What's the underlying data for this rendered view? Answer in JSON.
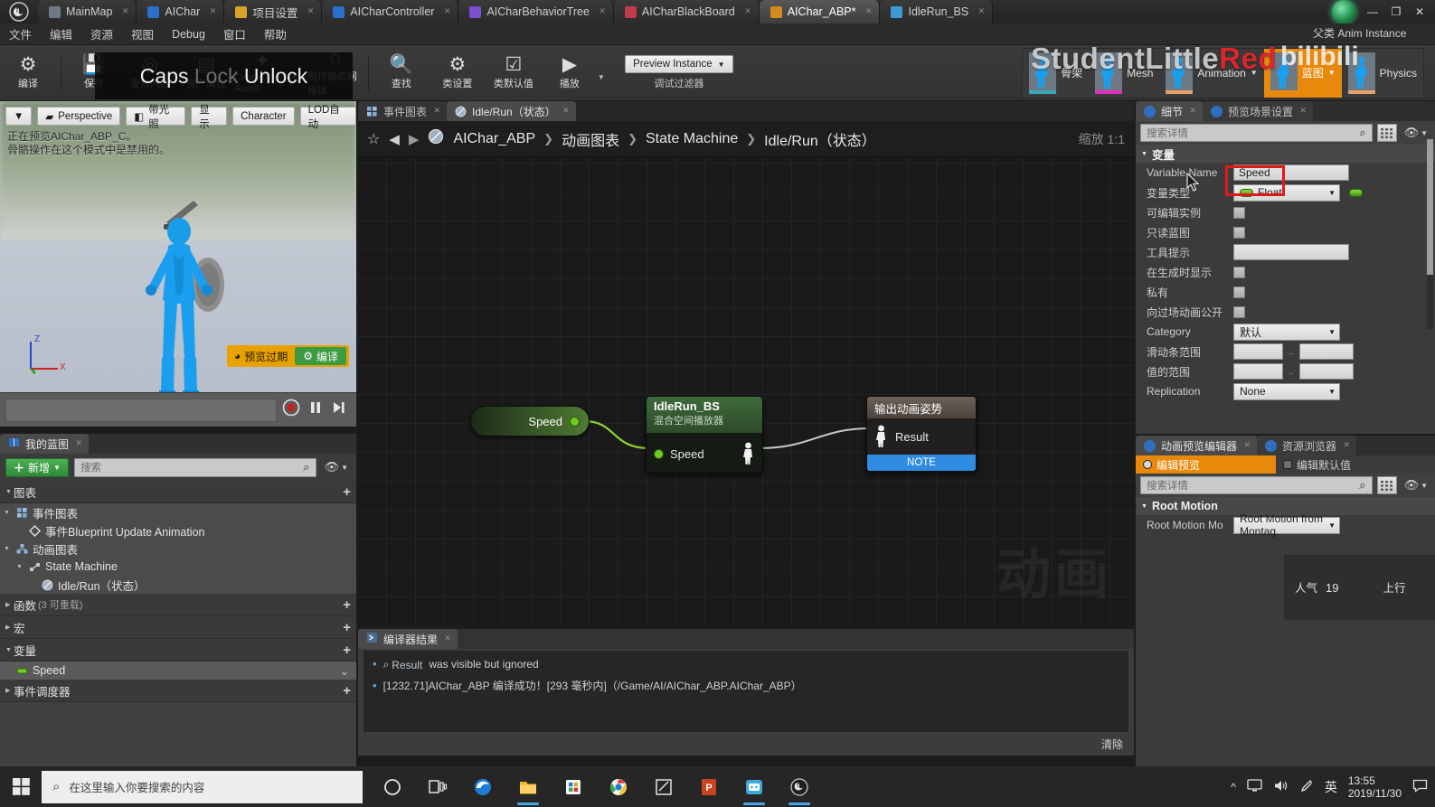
{
  "window": {
    "tabs": [
      {
        "label": "MainMap",
        "icon": "level-icon",
        "color": "#6f7a86",
        "active": false
      },
      {
        "label": "AIChar",
        "icon": "blueprint-icon",
        "color": "#2a6fc9",
        "active": false
      },
      {
        "label": "项目设置",
        "icon": "settings-icon",
        "color": "#d8a12a",
        "active": false
      },
      {
        "label": "AICharController",
        "icon": "blueprint-icon",
        "color": "#2a6fc9",
        "active": false
      },
      {
        "label": "AICharBehaviorTree",
        "icon": "behaviortree-icon",
        "color": "#7a4fd0",
        "active": false
      },
      {
        "label": "AICharBlackBoard",
        "icon": "blackboard-icon",
        "color": "#c23a4f",
        "active": false
      },
      {
        "label": "AIChar_ABP*",
        "icon": "animblueprint-icon",
        "color": "#d08a20",
        "active": true
      },
      {
        "label": "IdleRun_BS",
        "icon": "blendspace-icon",
        "color": "#3e9ad6",
        "active": false
      }
    ],
    "controls": {
      "minimize": "—",
      "maximize": "❐",
      "close": "✕"
    }
  },
  "menu": {
    "items": [
      "文件",
      "编辑",
      "资源",
      "视图",
      "Debug",
      "窗口",
      "帮助"
    ]
  },
  "toolbar": {
    "buttons": [
      {
        "label": "编译",
        "icon": "compile-icon"
      },
      {
        "label": "保存",
        "icon": "save-icon"
      },
      {
        "label": "查找内容",
        "icon": "browse-icon"
      },
      {
        "label": "资产属性",
        "icon": "asset-icon"
      },
      {
        "label": "Create Asset",
        "icon": "create-asset-icon",
        "caret": true
      },
      {
        "label": "制作静态网格体",
        "icon": "static-mesh-icon"
      },
      {
        "label": "查找",
        "icon": "find-icon"
      },
      {
        "label": "类设置",
        "icon": "class-settings-icon"
      },
      {
        "label": "类默认值",
        "icon": "class-defaults-icon"
      },
      {
        "label": "播放",
        "icon": "play-icon",
        "caret": true
      }
    ],
    "preview": {
      "value": "Preview Instance",
      "label": "调试过滤器",
      "icon": "chevron-down-icon"
    },
    "modes": [
      {
        "label": "骨架",
        "active": false,
        "accent": "#3ba7b8"
      },
      {
        "label": "Mesh",
        "active": false,
        "accent": "#e22fc1"
      },
      {
        "label": "Animation",
        "active": false,
        "accent": "#e8a06a",
        "caret": true
      },
      {
        "label": "蓝图",
        "active": true,
        "accent": "#e8890c",
        "caret": true
      },
      {
        "label": "Physics",
        "active": false,
        "accent": "#e8a06a"
      }
    ]
  },
  "overlays": {
    "caps_lock": {
      "word1": "Caps",
      "word2": "Lock",
      "word3": "Unlock"
    },
    "watermark_name": "StudentLittleRed",
    "watermark_brand": "bilibili",
    "parent_class": "父类 Anim Instance",
    "graph_watermark": "动画",
    "stream": {
      "popularity_label": "人气",
      "popularity_value": "19",
      "upload_label": "上行"
    }
  },
  "viewport": {
    "buttons": [
      {
        "label": "",
        "icon": "chevron-down-icon"
      },
      {
        "label": "Perspective",
        "icon": "camera-icon"
      },
      {
        "label": "带光照",
        "icon": "lit-cube-icon"
      },
      {
        "label": "显示",
        "icon": "show-icon"
      },
      {
        "label": "Character",
        "icon": "character-icon"
      },
      {
        "label": "LOD自动",
        "icon": "lod-icon"
      }
    ],
    "info_line1": "正在预览AIChar_ABP_C。",
    "info_line2": "骨骼操作在这个模式中是禁用的。",
    "axis": {
      "z": "Z",
      "x": "X",
      "y": "Y"
    },
    "warning": {
      "text": "预览过期",
      "icon": "warning-icon",
      "compile_label": "编译",
      "compile_icon": "gear-icon"
    },
    "transport": {
      "record": "record-icon",
      "pause": "pause-icon",
      "step": "step-forward-icon"
    }
  },
  "my_blueprint": {
    "tab": "我的蓝图",
    "tab_icon": "blueprint-book-icon",
    "add_label": "新增",
    "add_icon": "plus-icon",
    "search_placeholder": "搜索",
    "search_icon": "search-icon",
    "eye_icon": "eye-icon",
    "sections": [
      {
        "title": "图表",
        "sub": "",
        "plus": "+",
        "expanded": true,
        "items": [
          {
            "label": "事件图表",
            "icon": "event-graph-icon",
            "depth": 1,
            "arrow": true
          },
          {
            "label": "事件Blueprint Update Animation",
            "icon": "event-node-icon",
            "depth": 2,
            "arrow": false
          },
          {
            "label": "动画图表",
            "icon": "anim-graph-icon",
            "depth": 1,
            "arrow": true
          },
          {
            "label": "State Machine",
            "icon": "state-machine-icon",
            "depth": 2,
            "arrow": true
          },
          {
            "label": "Idle/Run（状态）",
            "icon": "state-icon",
            "depth": 3,
            "arrow": false
          }
        ]
      },
      {
        "title": "函数",
        "sub": "(3 可重载)",
        "plus": "+",
        "expanded": false,
        "items": []
      },
      {
        "title": "宏",
        "sub": "",
        "plus": "+",
        "expanded": false,
        "items": []
      },
      {
        "title": "变量",
        "sub": "",
        "plus": "+",
        "expanded": true,
        "items": [
          {
            "label": "Speed",
            "icon": "float-pin-icon",
            "depth": 1,
            "arrow": false,
            "selected": true,
            "trailing": "chevron-down-icon"
          }
        ]
      },
      {
        "title": "事件调度器",
        "sub": "",
        "plus": "+",
        "expanded": false,
        "items": []
      }
    ]
  },
  "graph": {
    "tabs": [
      {
        "label": "事件图表",
        "icon": "event-graph-icon",
        "active": false
      },
      {
        "label": "Idle/Run（状态）",
        "icon": "state-icon",
        "active": true
      }
    ],
    "nav": {
      "star": "favorite-icon",
      "back": "back-arrow-icon",
      "forward": "forward-arrow-icon"
    },
    "breadcrumb": [
      "AIChar_ABP",
      "动画图表",
      "State Machine",
      "Idle/Run（状态）"
    ],
    "breadcrumb_icon": "state-icon",
    "zoom_label": "缩放 1:1",
    "nodes": {
      "variable_get": {
        "title": "Speed",
        "pin": "output-pin"
      },
      "blendspace": {
        "title": "IdleRun_BS",
        "subtitle": "混合空间播放器",
        "input_pin_label": "Speed",
        "output_icon": "pose-pin-icon"
      },
      "output_pose": {
        "title": "输出动画姿势",
        "result_label": "Result",
        "result_icon": "pose-pin-icon",
        "note": "NOTE"
      }
    }
  },
  "compiler": {
    "tab": "编译器结果",
    "tab_icon": "compiler-icon",
    "messages": [
      {
        "bullet": "•",
        "link": "Result",
        "link_icon": "search-icon",
        "text": "was visible but ignored"
      },
      {
        "bullet": "•",
        "link": "",
        "text": "[1232.71]AIChar_ABP 编译成功！[293 毫秒内]（/Game/AI/AIChar_ABP.AIChar_ABP）"
      }
    ],
    "clear_label": "清除"
  },
  "details": {
    "tabs": [
      {
        "label": "细节",
        "icon": "details-icon",
        "active": true
      },
      {
        "label": "预览场景设置",
        "icon": "preview-scene-icon",
        "active": false
      }
    ],
    "search_placeholder": "搜索详情",
    "search_icon": "search-icon",
    "grid_icon": "grid-icon",
    "eye_icon": "eye-icon",
    "category": "变量",
    "rows": [
      {
        "label": "Variable Name",
        "type": "text",
        "value": "Speed",
        "highlight": true
      },
      {
        "label": "变量类型",
        "type": "dropdown",
        "value": "Float",
        "chip": "#6ecb22",
        "trailing_chip": true
      },
      {
        "label": "可编辑实例",
        "type": "checkbox",
        "value": false
      },
      {
        "label": "只读蓝图",
        "type": "checkbox",
        "value": false
      },
      {
        "label": "工具提示",
        "type": "text",
        "value": ""
      },
      {
        "label": "在生成时显示",
        "type": "checkbox",
        "value": false
      },
      {
        "label": "私有",
        "type": "checkbox",
        "value": false
      },
      {
        "label": "向过场动画公开",
        "type": "checkbox",
        "value": false
      },
      {
        "label": "Category",
        "type": "dropdown",
        "value": "默认"
      },
      {
        "label": "滑动条范围",
        "type": "range",
        "value": "",
        "value2": ""
      },
      {
        "label": "值的范围",
        "type": "range",
        "value": "",
        "value2": ""
      },
      {
        "label": "Replication",
        "type": "dropdown",
        "value": "None"
      }
    ]
  },
  "anim_preview": {
    "tabs": [
      {
        "label": "动画预览编辑器",
        "icon": "anim-preview-icon",
        "active": true
      },
      {
        "label": "资源浏览器",
        "icon": "asset-browser-icon",
        "active": false
      }
    ],
    "radios": [
      {
        "label": "编辑预览",
        "on": true
      },
      {
        "label": "编辑默认值",
        "on": false
      }
    ],
    "search_placeholder": "搜索详情",
    "search_icon": "search-icon",
    "grid_icon": "grid-icon",
    "eye_icon": "eye-icon",
    "category": "Root Motion",
    "rows": [
      {
        "label": "Root Motion Mo",
        "type": "dropdown",
        "value": "Root Motion from Montag"
      }
    ]
  },
  "taskbar": {
    "start_icon": "windows-icon",
    "search_placeholder": "在这里输入你要搜索的内容",
    "search_icon": "search-icon",
    "icons": [
      {
        "name": "cortana-icon",
        "running": false
      },
      {
        "name": "task-view-icon",
        "running": false
      },
      {
        "name": "edge-icon",
        "running": false
      },
      {
        "name": "file-explorer-icon",
        "running": true
      },
      {
        "name": "microsoft-store-icon",
        "running": false
      },
      {
        "name": "chrome-icon",
        "running": false
      },
      {
        "name": "snip-sketch-icon",
        "running": false
      },
      {
        "name": "powerpoint-icon",
        "running": false
      },
      {
        "name": "bilibili-live-icon",
        "running": true
      },
      {
        "name": "unreal-engine-icon",
        "running": true
      }
    ],
    "tray": {
      "chevron": "^",
      "network": "monitor-icon",
      "volume": "speaker-icon",
      "pen": "pen-icon",
      "ime": "英",
      "time": "13:55",
      "date": "2019/11/30",
      "action_center": "notification-icon"
    }
  }
}
